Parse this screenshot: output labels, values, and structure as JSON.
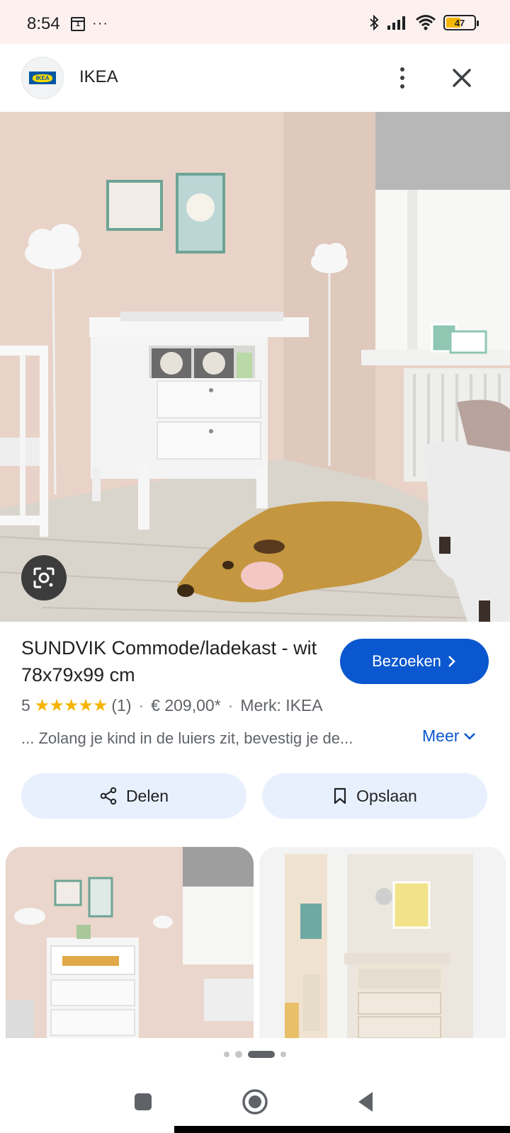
{
  "status_bar": {
    "time": "8:54",
    "calendar_day": "1",
    "more_dots": "···",
    "battery_level": "47"
  },
  "header": {
    "site_name": "IKEA",
    "logo_text": "IKEA"
  },
  "product": {
    "title": "SUNDVIK Commode/ladekast - wit 78x79x99 cm",
    "visit_label": "Bezoeken",
    "rating_value": "5",
    "stars": "★★★★★",
    "review_count": "(1)",
    "separator": "·",
    "price": "€ 209,00*",
    "brand": "Merk: IKEA",
    "snippet": "... Zolang je kind in de luiers zit, bevestig je de...",
    "more_label": "Meer"
  },
  "actions": {
    "share_label": "Delen",
    "save_label": "Opslaan"
  },
  "colors": {
    "accent": "#0b57d0",
    "button_bg": "#e8f0fe",
    "star": "#f5b400",
    "battery_fill": "#f5b800"
  },
  "icons": {
    "bluetooth": "bluetooth-icon",
    "signal": "signal-icon",
    "wifi": "wifi-icon",
    "more": "more-vert-icon",
    "close": "close-icon",
    "lens": "google-lens-icon",
    "share": "share-icon",
    "bookmark": "bookmark-icon"
  }
}
